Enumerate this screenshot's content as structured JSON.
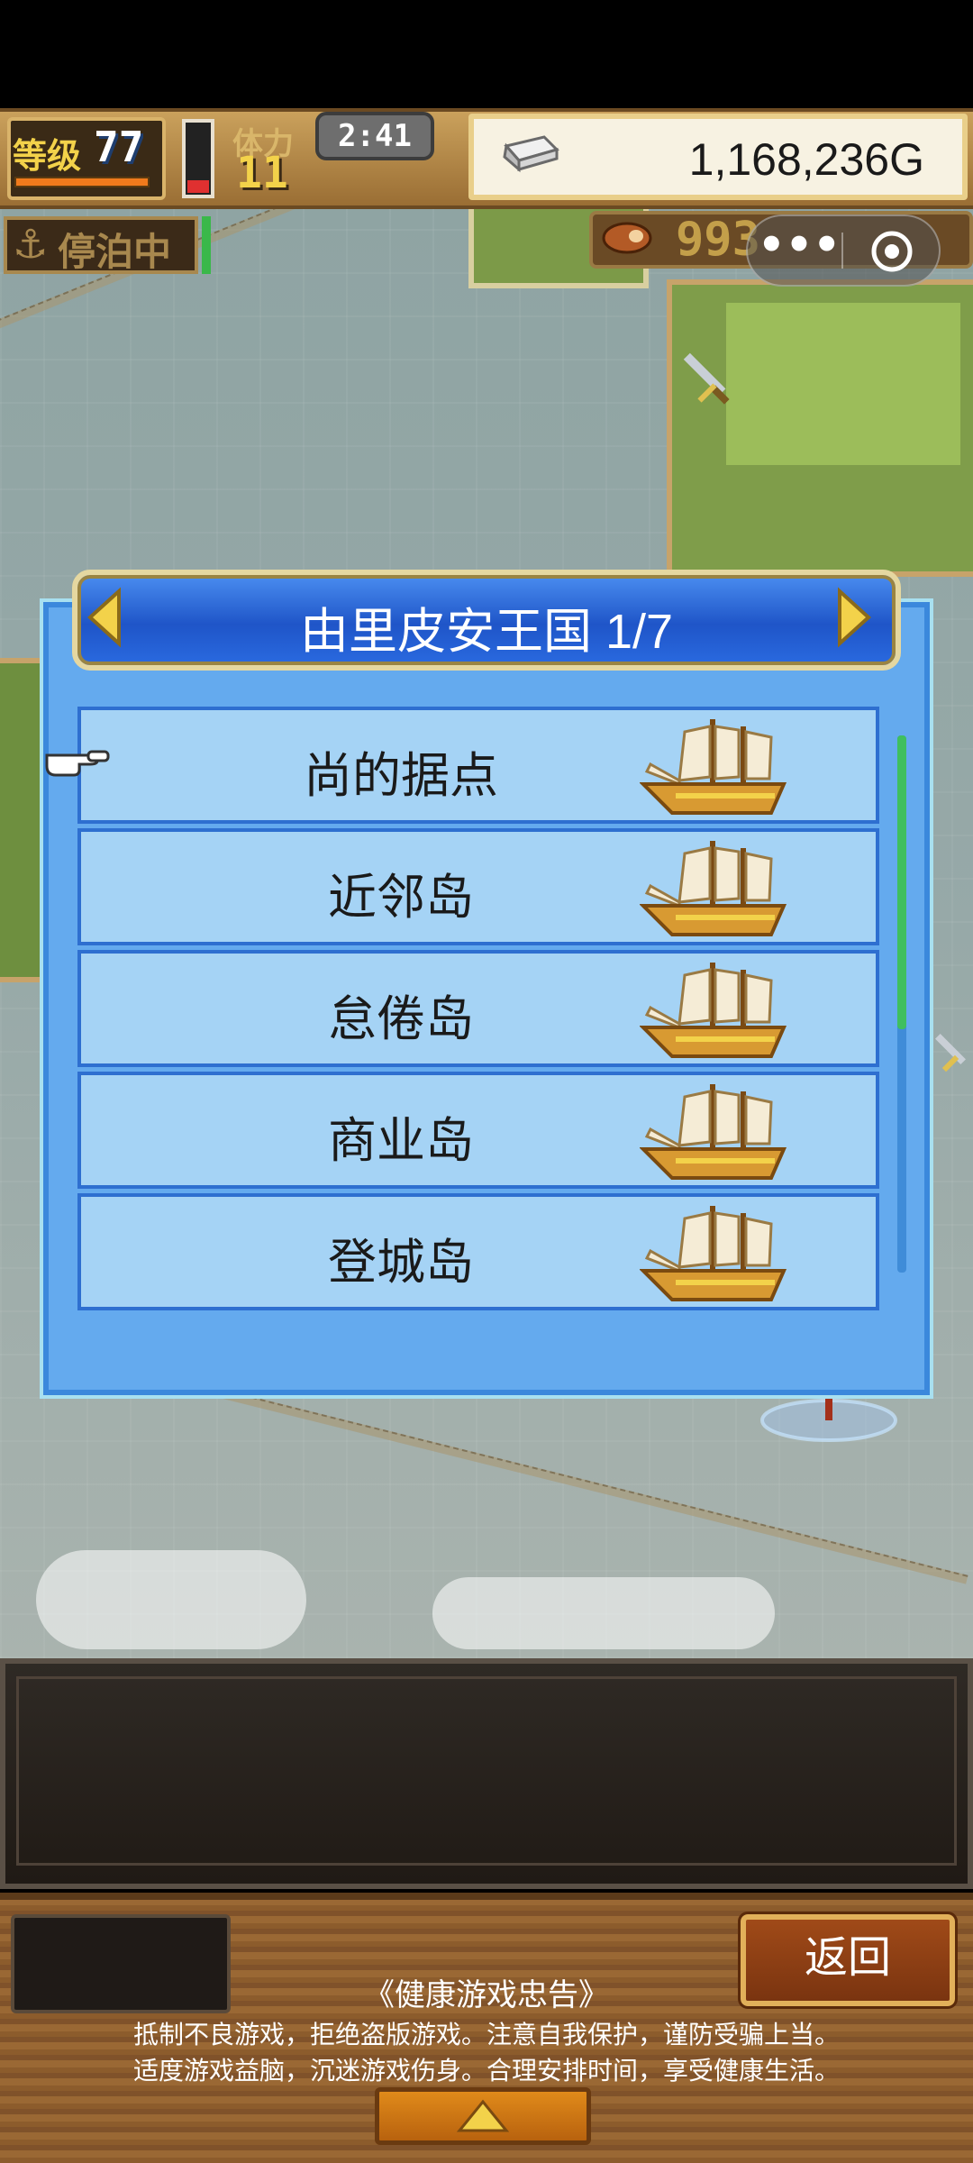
{
  "hud": {
    "level_label": "等级",
    "level_value": "77",
    "stamina_label": "体力",
    "stamina_value": "11",
    "clock": "2:41",
    "gold": "1,168,236G",
    "dock_status": "停泊中",
    "resource_value": "993"
  },
  "mini_program": {
    "more_label": "•••"
  },
  "dialog": {
    "title": "由里皮安王国 1/7",
    "destinations": [
      {
        "label": "尚的据点"
      },
      {
        "label": "近邻岛"
      },
      {
        "label": "怠倦岛"
      },
      {
        "label": "商业岛"
      },
      {
        "label": "登城岛"
      }
    ]
  },
  "footer": {
    "back_label": "返回",
    "notice_title": "《健康游戏忠告》",
    "notice_line1": "抵制不良游戏，拒绝盗版游戏。注意自我保护，谨防受骗上当。",
    "notice_line2": "适度游戏益脑，沉迷游戏伤身。合理安排时间，享受健康生活。"
  },
  "colors": {
    "dialog_bg": "#64aaee",
    "row_bg": "#a5d3f5",
    "header_blue": "#1f55c8",
    "gold_text": "#f3d24a"
  },
  "icons": [
    "anchor-icon",
    "silver-ingot-icon",
    "food-icon",
    "sword-icon",
    "ship-icon",
    "pointer-hand-icon",
    "arrow-left-icon",
    "arrow-right-icon",
    "triangle-up-icon"
  ]
}
